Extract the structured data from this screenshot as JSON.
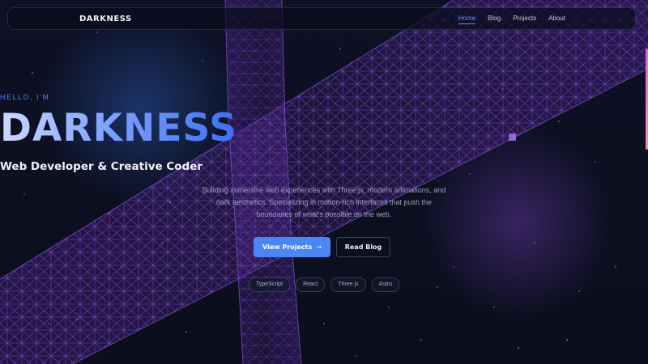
{
  "nav": {
    "brand": "DARKNESS",
    "links": [
      {
        "label": "Home",
        "active": true
      },
      {
        "label": "Blog",
        "active": false
      },
      {
        "label": "Projects",
        "active": false
      },
      {
        "label": "About",
        "active": false
      }
    ]
  },
  "hero": {
    "greeting": "HELLO, I'M",
    "title": "DARKNESS",
    "subtitle": "Web Developer & Creative Coder",
    "description": "Building immersive web experiences with Three.js, modern animations, and dark aesthetics. Specializing in motion-rich interfaces that push the boundaries of what's possible on the web.",
    "primary_button": {
      "label": "View Projects",
      "icon": "arrow-right-icon",
      "arrow": "→"
    },
    "secondary_button": {
      "label": "Read Blog"
    },
    "tags": [
      "TypeScript",
      "React",
      "Three.js",
      "Astro"
    ]
  },
  "colors": {
    "background": "#0b0e1c",
    "accent": "#4a86f5",
    "wireframe": "#8a4fd8",
    "title_gradient_start": "#cdd8ff",
    "title_gradient_end": "#3f6ff0"
  }
}
